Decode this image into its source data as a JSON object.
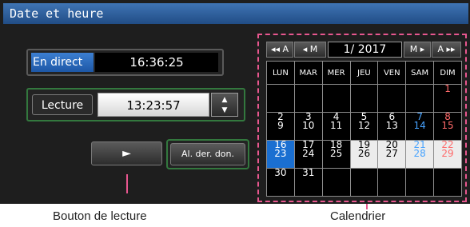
{
  "title": "Date et heure",
  "live": {
    "label": "En direct",
    "time": "16:36:25"
  },
  "playback": {
    "label": "Lecture",
    "time": "13:23:57",
    "up_icon": "triangle-up",
    "down_icon": "triangle-down"
  },
  "play_button": {
    "symbol": "►"
  },
  "last_data_button": {
    "label": "Al. der. don."
  },
  "calendar": {
    "nav": {
      "prev_year": "◂◂ A",
      "prev_month": "◂ M",
      "month_display": "1/ 2017",
      "next_month": "M ▸",
      "next_year": "A ▸▸"
    },
    "weekdays": [
      "LUN",
      "MAR",
      "MER",
      "JEU",
      "VEN",
      "SAM",
      "DIM"
    ],
    "weeks": [
      [
        "",
        "",
        "",
        "",
        "",
        "",
        "1"
      ],
      [
        "2\n9",
        "3\n10",
        "4\n11",
        "5\n12",
        "6\n13",
        "7\n14",
        "8\n15"
      ],
      [
        "16\n23",
        "17\n24",
        "18\n25",
        "19\n26",
        "20\n27",
        "21\n28",
        "22\n29"
      ],
      [
        "30",
        "31",
        "",
        "",
        "",
        "",
        ""
      ]
    ],
    "highlight_colors": {
      "selected": "#ececec",
      "today": "#1a6fd1",
      "saturday": "#47a3ff",
      "sunday": "#ff6a6a"
    }
  },
  "annotations": {
    "play_caption": "Bouton de lecture",
    "calendar_caption": "Calendrier"
  }
}
